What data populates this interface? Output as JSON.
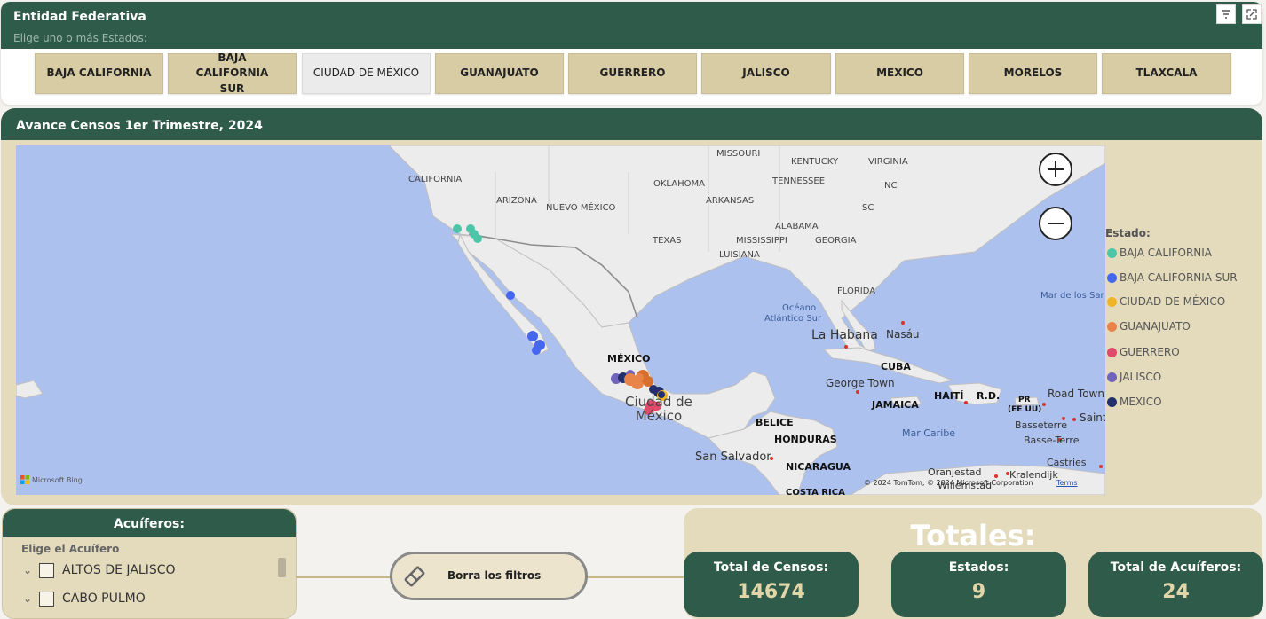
{
  "filter": {
    "title": "Entidad Federativa",
    "subtitle": "Elige uno o más Estados:",
    "buttons": [
      {
        "label": "BAJA CALIFORNIA",
        "selected": false
      },
      {
        "label": "BAJA CALIFORNIA SUR",
        "selected": false
      },
      {
        "label": "CIUDAD DE MÉXICO",
        "selected": true
      },
      {
        "label": "GUANAJUATO",
        "selected": false
      },
      {
        "label": "GUERRERO",
        "selected": false
      },
      {
        "label": "JALISCO",
        "selected": false
      },
      {
        "label": "MEXICO",
        "selected": false
      },
      {
        "label": "MORELOS",
        "selected": false
      },
      {
        "label": "TLAXCALA",
        "selected": false
      }
    ],
    "icons": [
      "filter-icon",
      "focus-mode-icon"
    ]
  },
  "map": {
    "title": "Avance Censos 1er Trimestre, 2024",
    "labels": {
      "missouri": "MISSOURI",
      "kentucky": "KENTUCKY",
      "virginia": "VIRGINIA",
      "california": "CALIFORNIA",
      "oklahoma": "OKLAHOMA",
      "tennessee": "TENNESSEE",
      "nc": "NC",
      "arizona": "ARIZONA",
      "nuevo_mexico": "NUEVO MÉXICO",
      "arkansas": "ARKANSAS",
      "sc": "SC",
      "alabama": "ALABAMA",
      "texas": "TEXAS",
      "mississippi": "MISSISSIPPI",
      "georgia": "GEORGIA",
      "luisiana": "LUISIANA",
      "florida": "FLORIDA",
      "mexico_country": "MÉXICO",
      "ciudad_mexico": "Ciudad de\nMéxico",
      "la_habana": "La Habana",
      "nasau": "Nasáu",
      "cuba": "CUBA",
      "george_town": "George Town",
      "jamaica": "JAMAICA",
      "haiti": "HAITÍ",
      "rd": "R.D.",
      "pr": "PR",
      "ee_uu": "(EE UU)",
      "road_town": "Road Town",
      "basseterre": "Basseterre",
      "saint": "Saint",
      "basse_terre": "Basse-Terre",
      "mar_caribe": "Mar Caribe",
      "belice": "BELICE",
      "honduras": "HONDURAS",
      "san_salvador": "San Salvador",
      "nicaragua": "NICARAGUA",
      "castries": "Castries",
      "oranjestad": "Oranjestad",
      "kralendijk": "Kralendijk",
      "willemstad": "Willemstad",
      "costa_rica": "COSTA RICA",
      "oceano": "Océano",
      "atlantico_sur": "Atlántico Sur",
      "mar_sargazos": "Mar de los Sar"
    },
    "attribution": "© 2024 TomTom, © 2024 Microsoft Corporation",
    "terms": "Terms",
    "bing": "Microsoft Bing",
    "zoom_in_icon": "zoom-in-icon",
    "zoom_out_icon": "zoom-out-icon"
  },
  "legend": {
    "title": "Estado:",
    "items": [
      {
        "label": "BAJA CALIFORNIA",
        "color": "#4dc5a8"
      },
      {
        "label": "BAJA CALIFORNIA SUR",
        "color": "#4566f0"
      },
      {
        "label": "CIUDAD DE MÉXICO",
        "color": "#f0b429"
      },
      {
        "label": "GUANAJUATO",
        "color": "#e8834a"
      },
      {
        "label": "GUERRERO",
        "color": "#e04a6b"
      },
      {
        "label": "JALISCO",
        "color": "#7063bd"
      },
      {
        "label": "MEXICO",
        "color": "#23306e"
      }
    ]
  },
  "aquifers": {
    "title": "Acuíferos:",
    "subtitle": "Elige el Acuífero",
    "items": [
      {
        "label": "ALTOS DE JALISCO",
        "checked": false
      },
      {
        "label": "CABO PULMO",
        "checked": false
      }
    ]
  },
  "clear_filters": {
    "label": "Borra los filtros",
    "icon": "eraser-icon"
  },
  "totals": {
    "title": "Totales:",
    "kpis": [
      {
        "label": "Total de Censos:",
        "value": "14674"
      },
      {
        "label": "Estados:",
        "value": "9"
      },
      {
        "label": "Total de Acuíferos:",
        "value": "24"
      }
    ]
  }
}
